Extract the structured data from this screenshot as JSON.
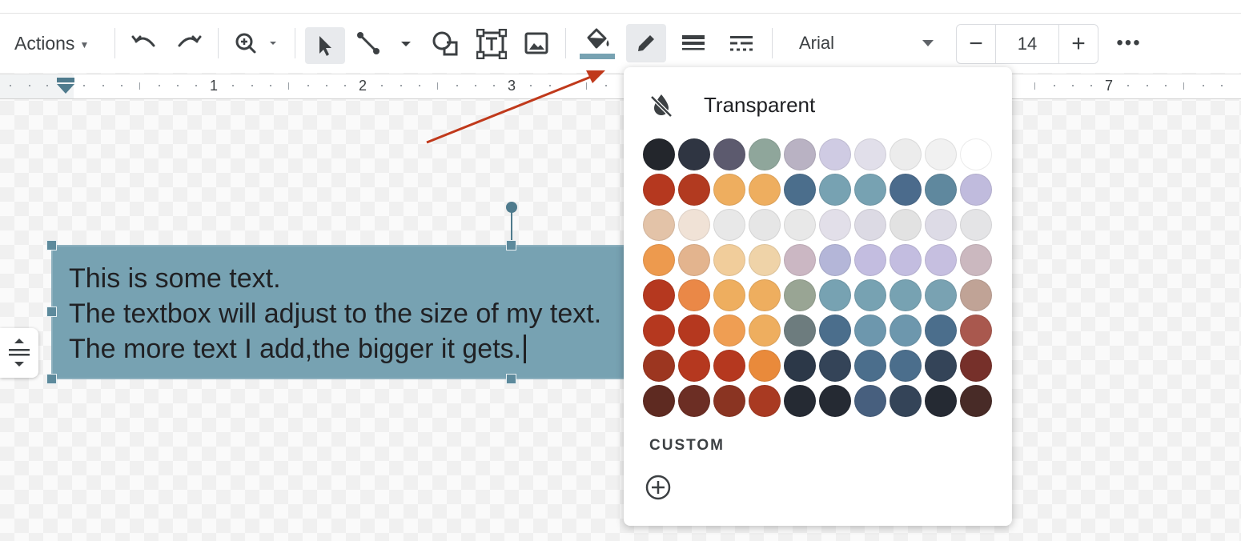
{
  "toolbar": {
    "actions_label": "Actions",
    "font_name": "Arial",
    "font_size": "14",
    "minus_label": "−",
    "plus_label": "+",
    "more_label": "•••",
    "fill_color": "#77a2b2"
  },
  "ruler": {
    "marks": [
      "1",
      "2",
      "3",
      "7"
    ]
  },
  "textbox": {
    "lines": [
      "This is some text.",
      "The textbox will adjust to the size of my text.",
      "The more text I add,the bigger it gets."
    ],
    "fill": "#77a2b2"
  },
  "palette": {
    "transparent_label": "Transparent",
    "custom_label": "CUSTOM",
    "rows": [
      [
        "#23262c",
        "#2f3542",
        "#5c5a6e",
        "#8fa69b",
        "#b9b2c3",
        "#cfcbe3",
        "#e1dfea",
        "#ececec",
        "#f1f1f1",
        "#ffffff"
      ],
      [
        "#b5381f",
        "#b23a20",
        "#eeae5f",
        "#eeae5f",
        "#4b6e8c",
        "#77a2b2",
        "#77a2b2",
        "#4b6b8c",
        "#5f889e",
        "#c0bbdd"
      ],
      [
        "#e3c3a8",
        "#f0e2d6",
        "#e8e8e8",
        "#e6e6e6",
        "#e8e8e8",
        "#e2dfe9",
        "#dcdae4",
        "#e2e2e2",
        "#dddbe6",
        "#e4e4e6"
      ],
      [
        "#ed9a4e",
        "#e3b48e",
        "#f1cd9b",
        "#efd3a8",
        "#cbb7c3",
        "#b4b6d8",
        "#c3bde0",
        "#c3bde0",
        "#c6bfe0",
        "#cbb8bf"
      ],
      [
        "#b5381f",
        "#ea8847",
        "#eeae5f",
        "#eeae5f",
        "#99a594",
        "#77a2b2",
        "#77a2b2",
        "#77a2b2",
        "#79a2b2",
        "#c0a396"
      ],
      [
        "#b5381f",
        "#b5381f",
        "#ef9e53",
        "#eeae5f",
        "#6d7c7e",
        "#4b6e8c",
        "#6d97ad",
        "#6d97ad",
        "#4b6e8c",
        "#a9584e"
      ],
      [
        "#9c3620",
        "#b5381f",
        "#b5381f",
        "#e98a3b",
        "#2c3848",
        "#344458",
        "#4b6e8c",
        "#4b6e8c",
        "#344458",
        "#76302a"
      ],
      [
        "#5e2a21",
        "#6c2e24",
        "#8a3422",
        "#a93a22",
        "#252a33",
        "#252a33",
        "#475f7e",
        "#344458",
        "#252a33",
        "#482b27"
      ]
    ]
  }
}
